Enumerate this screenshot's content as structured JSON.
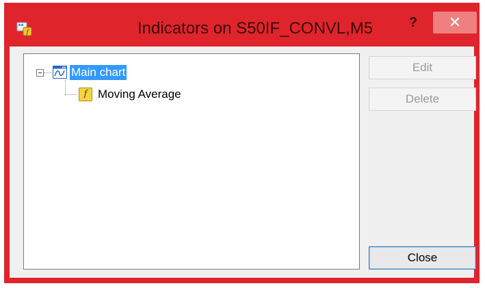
{
  "window": {
    "title": "Indicators on S50IF_CONVL,M5",
    "help_glyph": "?",
    "close_glyph": "✕",
    "frame_color": "#e0242c"
  },
  "tree": {
    "root": {
      "label": "Main chart",
      "icon": "chart-window-icon",
      "expanded": true,
      "selected": true
    },
    "children": [
      {
        "label": "Moving Average",
        "icon": "function-icon",
        "icon_glyph": "f"
      }
    ]
  },
  "buttons": {
    "edit_label": "Edit",
    "delete_label": "Delete",
    "close_label": "Close"
  }
}
